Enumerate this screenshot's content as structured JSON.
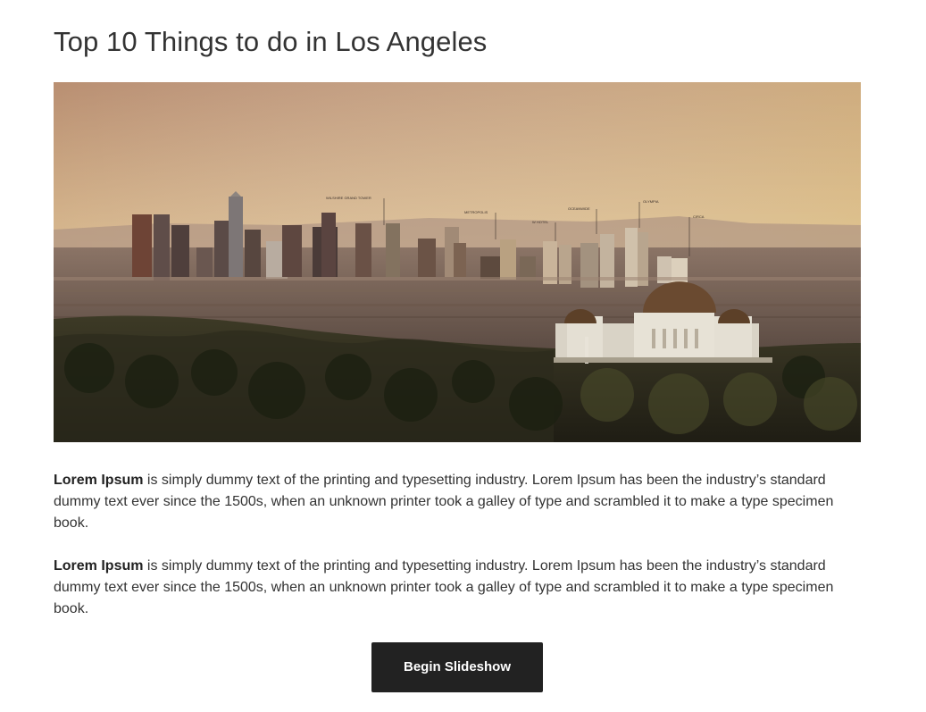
{
  "page": {
    "title": "Top 10 Things to do in Los Angeles"
  },
  "hero_image": {
    "subject": "Los Angeles skyline with observatory",
    "tower_labels": [
      "WILSHIRE GRAND TOWER",
      "METROPOLIS",
      "W HOTEL",
      "OCEANWIDE",
      "OLYMPIA",
      "CIRCA"
    ]
  },
  "content": {
    "paragraphs": [
      {
        "lead": "Lorem Ipsum",
        "body": " is simply dummy text of the printing and typesetting industry. Lorem Ipsum has been the industry’s standard dummy text ever since the 1500s, when an unknown printer took a galley of type and scrambled it to make a type specimen book."
      },
      {
        "lead": "Lorem Ipsum",
        "body": " is simply dummy text of the printing and typesetting industry. Lorem Ipsum has been the industry’s standard dummy text ever since the 1500s, when an unknown printer took a galley of type and scrambled it to make a type specimen book."
      }
    ]
  },
  "actions": {
    "slideshow_label": "Begin Slideshow"
  },
  "colors": {
    "text": "#333333",
    "button_bg": "#222222",
    "button_text": "#ffffff",
    "sky_top": "#c9a47c",
    "sky_bottom": "#e0c79e"
  }
}
